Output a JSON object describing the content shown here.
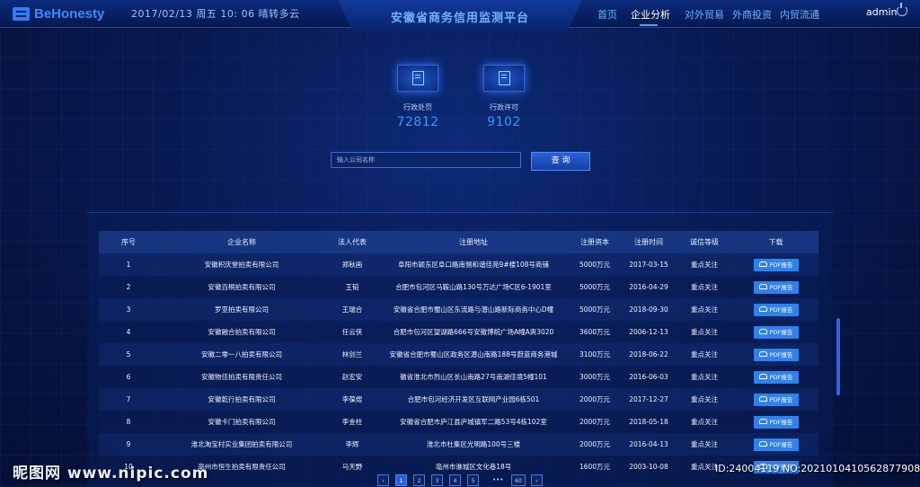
{
  "header": {
    "brand": "BeHonesty",
    "datetime": "2017/02/13  周五 10: 06  晴转多云",
    "title": "安徽省商务信用监测平台",
    "nav": [
      "首页",
      "企业分析",
      "对外贸易",
      "外商投资",
      "内贸流通"
    ],
    "active_nav": "企业分析",
    "user": "admin"
  },
  "stats": [
    {
      "label": "行政处罚",
      "value": "72812",
      "icon": "document-icon"
    },
    {
      "label": "行政许可",
      "value": "9102",
      "icon": "document-icon"
    }
  ],
  "search": {
    "placeholder": "输入公司名称",
    "button": "查 询"
  },
  "table": {
    "headers": [
      "序号",
      "企业名称",
      "法人代表",
      "注册地址",
      "注册资本",
      "注册时间",
      "诚信等级",
      "下载"
    ],
    "download_label": "PDF报告",
    "rows": [
      [
        "1",
        "安徽积庆堂拍卖有限公司",
        "郑秋画",
        "阜阳市颍东区阜口路南侧和谐佳苑9#楼108号商铺",
        "5000万元",
        "2017-03-15",
        "重点关注"
      ],
      [
        "2",
        "安徽百桐拍卖有限公司",
        "王韬",
        "合肥市包河区马鞍山路130号万达广场C区6-1901室",
        "5000万元",
        "2016-04-29",
        "重点关注"
      ],
      [
        "3",
        "罗亚拍卖有限公司",
        "王瑞合",
        "安徽省合肥市蜀山区东流路与潜山路新际商务中心D幢",
        "5000万元",
        "2018-09-30",
        "重点关注"
      ],
      [
        "4",
        "安徽融合拍卖有限公司",
        "任云侠",
        "合肥市包河区望湖路666号安徽博皖广场A幢A爽3020",
        "3600万元",
        "2006-12-13",
        "重点关注"
      ],
      [
        "5",
        "安徽二零一八拍卖有限公司",
        "林剑兰",
        "安徽省合肥市蜀山区政务区潜山南路188号蔚蓝商务港城",
        "3100万元",
        "2018-06-22",
        "重点关注"
      ],
      [
        "6",
        "安徽物佳拍卖有限责任公司",
        "赵宏安",
        "徽省淮北市烈山区长山南路27号南湖佳境5幢101",
        "3000万元",
        "2016-06-03",
        "重点关注"
      ],
      [
        "7",
        "安徽乾行拍卖有限公司",
        "李葆煜",
        "合肥市包河经济开发区互联网产业园6栋501",
        "2000万元",
        "2017-12-27",
        "重点关注"
      ],
      [
        "8",
        "安徽卡门拍卖有限公司",
        "李金柱",
        "安徽省合肥市庐江县庐城镇军二路53号4栋102室",
        "2000万元",
        "2018-05-18",
        "重点关注"
      ],
      [
        "9",
        "淮北淘宝村实业集团拍卖有限公司",
        "李辉",
        "淮北市杜集区光明路100号三楼",
        "2000万元",
        "2016-04-13",
        "重点关注"
      ],
      [
        "10",
        "亳州市恒生拍卖有限责任公司",
        "马天野",
        "亳州市谯城区文化巷18号",
        "1600万元",
        "2003-10-08",
        "重点关注"
      ]
    ]
  },
  "pagination": {
    "pages": [
      "1",
      "2",
      "3",
      "4",
      "5"
    ],
    "last": "60",
    "active": "1"
  },
  "watermark": {
    "site": "昵图网 www.nipic.com",
    "id": "ID:24004119 NO:20210104105628779083"
  },
  "colors": {
    "accent": "#2f82ee",
    "title": "#6fb2ff",
    "value": "#2f9cff"
  }
}
